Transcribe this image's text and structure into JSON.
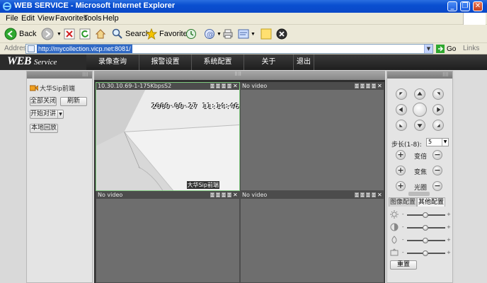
{
  "window": {
    "title": "WEB SERVICE - Microsoft Internet Explorer",
    "minimize_label": "_",
    "restore_label": "❐",
    "close_label": "✕"
  },
  "menu": [
    "File",
    "Edit",
    "View",
    "Favorites",
    "Tools",
    "Help"
  ],
  "toolbar": {
    "back": "Back",
    "search": "Search",
    "favorites": "Favorites"
  },
  "address": {
    "label": "Address",
    "url": "http://mycollection.vicp.net:8081/",
    "go": "Go",
    "links": "Links"
  },
  "app": {
    "logo_main": "WEB",
    "logo_sub": "Service",
    "nav": [
      "录像查询",
      "报警设置",
      "系统配置",
      "关于",
      "退出"
    ],
    "left": {
      "camera_name": "大华Sip前端",
      "close_all": "全部关闭",
      "refresh": "刷新",
      "start_talk": "开始对讲",
      "local_playback": "本地回放"
    },
    "video": {
      "cells": [
        {
          "label": "10.30.10.69-1-175KbpsS2",
          "timestamp": "2009-09-27 11:14:46",
          "osd": "大华Sip前端"
        },
        {
          "label": "No video"
        },
        {
          "label": "No video"
        },
        {
          "label": "No video"
        }
      ]
    },
    "ptz": {
      "step_label": "步长(1-8):",
      "step_value": "5",
      "zoom_label": "变倍",
      "focus_label": "变焦",
      "iris_label": "光圈"
    },
    "image": {
      "tab_image": "图像配置",
      "tab_other": "其他配置",
      "sliders": [
        {
          "name": "brightness",
          "value": 0.5
        },
        {
          "name": "contrast",
          "value": 0.5
        },
        {
          "name": "saturation",
          "value": 0.5
        },
        {
          "name": "hue",
          "value": 0.5
        }
      ],
      "minus": "-",
      "plus": "+",
      "reset": "重置"
    }
  }
}
